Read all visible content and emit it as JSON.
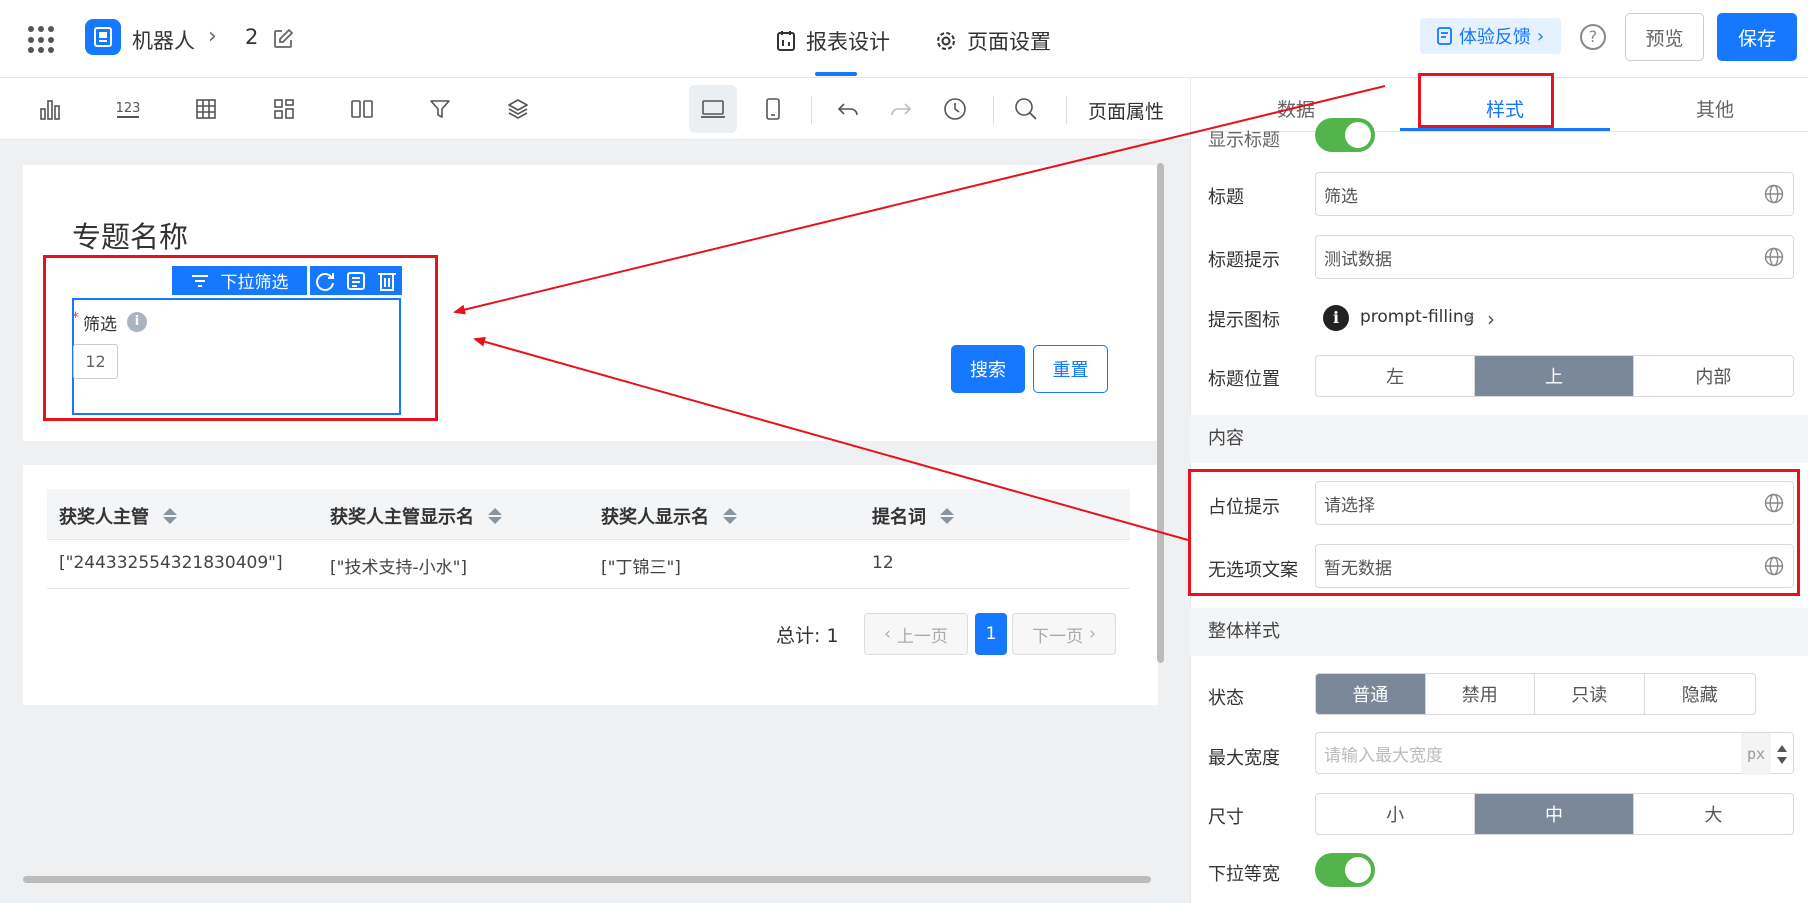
{
  "header": {
    "app_name": "机器人",
    "crumb_sep": "›",
    "report_id": "2",
    "tab_design": "报表设计",
    "tab_page_settings": "页面设置",
    "feedback_label": "体验反馈",
    "help": "?",
    "preview_label": "预览",
    "save_label": "保存",
    "accent": "#1677ff"
  },
  "toolbar": {
    "icons": [
      "bar-chart-icon",
      "number-icon",
      "table-icon",
      "grid-icon",
      "columns-icon",
      "filter-icon",
      "layers-icon",
      "desktop-icon",
      "mobile-icon",
      "undo-icon",
      "redo-icon",
      "history-icon",
      "search-icon"
    ],
    "number_glyph": "123",
    "page_attr_label": "页面属性"
  },
  "canvas": {
    "topic_title": "专题名称",
    "filter_widget_label": "下拉筛选",
    "filter_label": "筛选",
    "required_star": "*",
    "info_glyph": "i",
    "filter_value": "12",
    "search_label": "搜索",
    "reset_label": "重置",
    "table": {
      "columns": [
        "获奖人主管",
        "获奖人主管显示名",
        "获奖人显示名",
        "提名词"
      ],
      "rows": [
        [
          "[\"244332554321830409\"]",
          "[\"技术支持-小水\"]",
          "[\"丁锦三\"]",
          "12"
        ]
      ]
    },
    "pagination": {
      "total_label": "总计: 1",
      "prev_label": "上一页",
      "page": "1",
      "next_label": "下一页"
    }
  },
  "panel": {
    "tabs": [
      "数据",
      "样式",
      "其他"
    ],
    "active_tab": "样式",
    "show_title_label": "显示标题",
    "title_label": "标题",
    "title_value": "筛选",
    "title_tip_label": "标题提示",
    "title_tip_value": "测试数据",
    "tip_icon_label": "提示图标",
    "tip_icon_glyph": "i",
    "tip_icon_name": "prompt-filling",
    "tip_icon_clear": "×",
    "tip_icon_chevron": "›",
    "title_pos_label": "标题位置",
    "title_pos_options": [
      "左",
      "上",
      "内部"
    ],
    "title_pos_selected": "上",
    "section_content": "内容",
    "placeholder_label": "占位提示",
    "placeholder_value": "请选择",
    "empty_label": "无选项文案",
    "empty_value": "暂无数据",
    "section_style": "整体样式",
    "state_label": "状态",
    "state_options": [
      "普通",
      "禁用",
      "只读",
      "隐藏"
    ],
    "state_selected": "普通",
    "max_width_label": "最大宽度",
    "max_width_placeholder": "请输入最大宽度",
    "max_width_unit": "px",
    "size_label": "尺寸",
    "size_options": [
      "小",
      "中",
      "大"
    ],
    "size_selected": "中",
    "dropdown_equal_label": "下拉等宽",
    "toggle_color": "#52b44b",
    "selected_color": "#7a8899"
  },
  "annotation_color": "#e8121b"
}
